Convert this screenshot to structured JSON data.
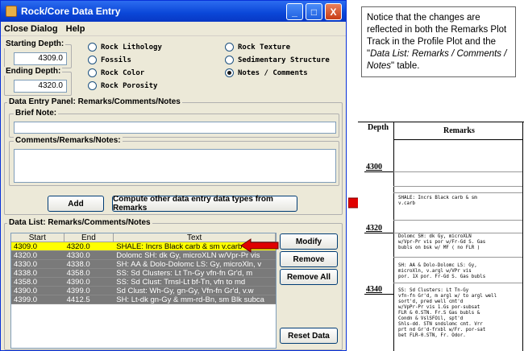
{
  "window": {
    "title": "Rock/Core Data Entry",
    "minimize_label": "_",
    "maximize_label": "□",
    "close_label": "X"
  },
  "menu": [
    "Close Dialog",
    "Help"
  ],
  "depth": {
    "starting_label": "Starting Depth:",
    "starting_value": "4309.0",
    "ending_label": "Ending Depth:",
    "ending_value": "4320.0"
  },
  "types": [
    {
      "label": "Rock Lithology",
      "selected": false
    },
    {
      "label": "Rock Texture",
      "selected": false
    },
    {
      "label": "Fossils",
      "selected": false
    },
    {
      "label": "Sedimentary Structure",
      "selected": false
    },
    {
      "label": "Rock Color",
      "selected": false
    },
    {
      "label": "Notes / Comments",
      "selected": true
    },
    {
      "label": "Rock Porosity",
      "selected": false
    }
  ],
  "entry_panel": {
    "title": "Data Entry Panel: Remarks/Comments/Notes",
    "brief_label": "Brief Note:",
    "brief_value": "",
    "comments_label": "Comments/Remarks/Notes:",
    "comments_value": "",
    "add_button": "Add",
    "compute_button": "Compute other data entry data types from Remarks"
  },
  "data_list": {
    "title": "Data List: Remarks/Comments/Notes",
    "columns": [
      "Start",
      "End",
      "Text"
    ],
    "rows": [
      {
        "start": "4309.0",
        "end": "4320.0",
        "text": "SHALE: Incrs Black carb & sm v.carb",
        "selected": true
      },
      {
        "start": "4320.0",
        "end": "4330.0",
        "text": "Dolomc SH: dk Gy, microXLN w/Vpr-Pr vis",
        "selected": false
      },
      {
        "start": "4330.0",
        "end": "4338.0",
        "text": "SH: AA & Dolo-Dolomc LS: Gy, microXln, v",
        "selected": false
      },
      {
        "start": "4338.0",
        "end": "4358.0",
        "text": "SS: Sd Clusters: Lt Tn-Gy vfn-fn Gr'd, m",
        "selected": false
      },
      {
        "start": "4358.0",
        "end": "4390.0",
        "text": "SS: Sd Clust: Trnsl-Lt bf-Tn, vfn to md",
        "selected": false
      },
      {
        "start": "4390.0",
        "end": "4399.0",
        "text": "Sd Clust: Wh-Gy, gn-Gy, Vfn-fn Gr'd, v.w",
        "selected": false
      },
      {
        "start": "4399.0",
        "end": "4412.5",
        "text": "SH: Lt-dk gn-Gy & mm-rd-Bn, sm Blk subca",
        "selected": false
      }
    ],
    "modify_button": "Modify",
    "remove_button": "Remove",
    "remove_all_button": "Remove All",
    "reset_button": "Reset Data"
  },
  "annotation": {
    "text_plain": "Notice that the changes are reflected in both the Remarks Plot Track in the Profile Plot and the \"",
    "text_italic": "Data List: Remarks / Comments / Notes",
    "text_end": "\" table."
  },
  "profile_plot": {
    "depth_header": "Depth",
    "remarks_header": "Remarks",
    "depth_labels": [
      "4300",
      "4320",
      "4340"
    ],
    "remarks": [
      "SHALE: Incrs Black carb & sm\nv.carb",
      "Dolomc SH: dk Gy, microXLN\nw/Vpr-Pr vis por w/Fr-Gd S. Gas\nbubls on bsk w/ MF ( no FLR )",
      "SH: AA & Dolo-Dolomc LS: Gy,\nmicroXln, v.argl w/VPr vis\npor. 1X por. Fr-Gd S. Gas bubls",
      "SS: Sd Clusters: Lt Tn-Gy\nvfn-fn Gr'd, m argl w/ to argl well\nsort'd, pred well cmt'd\nw/VpPr-Pr vis 1.Gs por-subsat\nFLR & 0.STN. Fr.S Gas bubls &\nCondn & VslSFOil, spt'd\nShls-dd. STN sndslomc cmt. Vrr\nprt nd Gr'd-frxbl w/Fr. por-sat\nbet FLR-0.STN, Fr. Odor."
    ],
    "colors": {
      "selected_row": "#ffff00",
      "arrow": "#e00000"
    }
  }
}
